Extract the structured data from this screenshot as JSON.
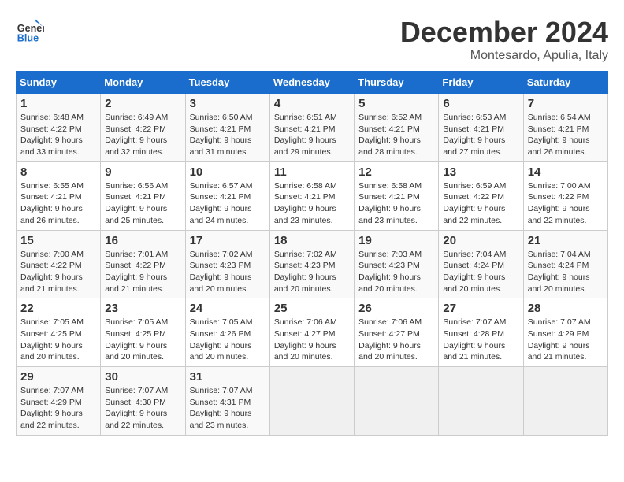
{
  "header": {
    "logo_line1": "General",
    "logo_line2": "Blue",
    "month": "December 2024",
    "location": "Montesardo, Apulia, Italy"
  },
  "weekdays": [
    "Sunday",
    "Monday",
    "Tuesday",
    "Wednesday",
    "Thursday",
    "Friday",
    "Saturday"
  ],
  "weeks": [
    [
      {
        "day": 1,
        "sunrise": "6:48 AM",
        "sunset": "4:22 PM",
        "daylight": "9 hours and 33 minutes."
      },
      {
        "day": 2,
        "sunrise": "6:49 AM",
        "sunset": "4:22 PM",
        "daylight": "9 hours and 32 minutes."
      },
      {
        "day": 3,
        "sunrise": "6:50 AM",
        "sunset": "4:21 PM",
        "daylight": "9 hours and 31 minutes."
      },
      {
        "day": 4,
        "sunrise": "6:51 AM",
        "sunset": "4:21 PM",
        "daylight": "9 hours and 29 minutes."
      },
      {
        "day": 5,
        "sunrise": "6:52 AM",
        "sunset": "4:21 PM",
        "daylight": "9 hours and 28 minutes."
      },
      {
        "day": 6,
        "sunrise": "6:53 AM",
        "sunset": "4:21 PM",
        "daylight": "9 hours and 27 minutes."
      },
      {
        "day": 7,
        "sunrise": "6:54 AM",
        "sunset": "4:21 PM",
        "daylight": "9 hours and 26 minutes."
      }
    ],
    [
      {
        "day": 8,
        "sunrise": "6:55 AM",
        "sunset": "4:21 PM",
        "daylight": "9 hours and 26 minutes."
      },
      {
        "day": 9,
        "sunrise": "6:56 AM",
        "sunset": "4:21 PM",
        "daylight": "9 hours and 25 minutes."
      },
      {
        "day": 10,
        "sunrise": "6:57 AM",
        "sunset": "4:21 PM",
        "daylight": "9 hours and 24 minutes."
      },
      {
        "day": 11,
        "sunrise": "6:58 AM",
        "sunset": "4:21 PM",
        "daylight": "9 hours and 23 minutes."
      },
      {
        "day": 12,
        "sunrise": "6:58 AM",
        "sunset": "4:21 PM",
        "daylight": "9 hours and 23 minutes."
      },
      {
        "day": 13,
        "sunrise": "6:59 AM",
        "sunset": "4:22 PM",
        "daylight": "9 hours and 22 minutes."
      },
      {
        "day": 14,
        "sunrise": "7:00 AM",
        "sunset": "4:22 PM",
        "daylight": "9 hours and 22 minutes."
      }
    ],
    [
      {
        "day": 15,
        "sunrise": "7:00 AM",
        "sunset": "4:22 PM",
        "daylight": "9 hours and 21 minutes."
      },
      {
        "day": 16,
        "sunrise": "7:01 AM",
        "sunset": "4:22 PM",
        "daylight": "9 hours and 21 minutes."
      },
      {
        "day": 17,
        "sunrise": "7:02 AM",
        "sunset": "4:23 PM",
        "daylight": "9 hours and 20 minutes."
      },
      {
        "day": 18,
        "sunrise": "7:02 AM",
        "sunset": "4:23 PM",
        "daylight": "9 hours and 20 minutes."
      },
      {
        "day": 19,
        "sunrise": "7:03 AM",
        "sunset": "4:23 PM",
        "daylight": "9 hours and 20 minutes."
      },
      {
        "day": 20,
        "sunrise": "7:04 AM",
        "sunset": "4:24 PM",
        "daylight": "9 hours and 20 minutes."
      },
      {
        "day": 21,
        "sunrise": "7:04 AM",
        "sunset": "4:24 PM",
        "daylight": "9 hours and 20 minutes."
      }
    ],
    [
      {
        "day": 22,
        "sunrise": "7:05 AM",
        "sunset": "4:25 PM",
        "daylight": "9 hours and 20 minutes."
      },
      {
        "day": 23,
        "sunrise": "7:05 AM",
        "sunset": "4:25 PM",
        "daylight": "9 hours and 20 minutes."
      },
      {
        "day": 24,
        "sunrise": "7:05 AM",
        "sunset": "4:26 PM",
        "daylight": "9 hours and 20 minutes."
      },
      {
        "day": 25,
        "sunrise": "7:06 AM",
        "sunset": "4:27 PM",
        "daylight": "9 hours and 20 minutes."
      },
      {
        "day": 26,
        "sunrise": "7:06 AM",
        "sunset": "4:27 PM",
        "daylight": "9 hours and 20 minutes."
      },
      {
        "day": 27,
        "sunrise": "7:07 AM",
        "sunset": "4:28 PM",
        "daylight": "9 hours and 21 minutes."
      },
      {
        "day": 28,
        "sunrise": "7:07 AM",
        "sunset": "4:29 PM",
        "daylight": "9 hours and 21 minutes."
      }
    ],
    [
      {
        "day": 29,
        "sunrise": "7:07 AM",
        "sunset": "4:29 PM",
        "daylight": "9 hours and 22 minutes."
      },
      {
        "day": 30,
        "sunrise": "7:07 AM",
        "sunset": "4:30 PM",
        "daylight": "9 hours and 22 minutes."
      },
      {
        "day": 31,
        "sunrise": "7:07 AM",
        "sunset": "4:31 PM",
        "daylight": "9 hours and 23 minutes."
      },
      null,
      null,
      null,
      null
    ]
  ]
}
